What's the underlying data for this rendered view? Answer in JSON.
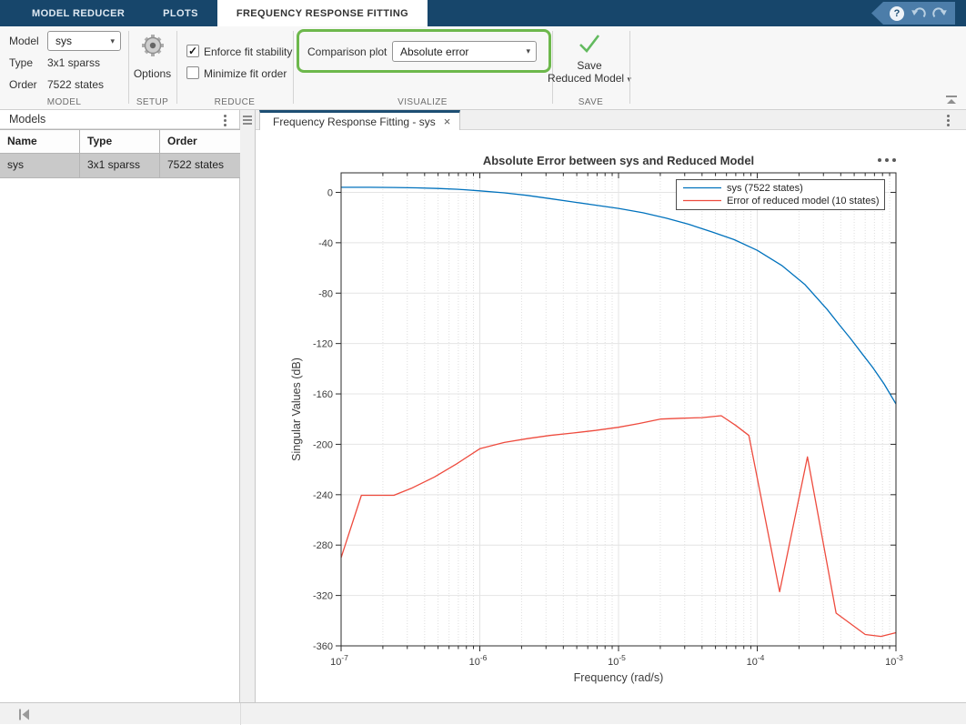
{
  "titlebar": {
    "tab_model_reducer": "MODEL REDUCER",
    "tab_plots": "PLOTS",
    "tab_frf": "FREQUENCY RESPONSE FITTING",
    "help_glyph": "?"
  },
  "ribbon": {
    "model": {
      "section": "MODEL",
      "model_label": "Model",
      "model_value": "sys",
      "type_label": "Type",
      "type_value": "3x1 sparss",
      "order_label": "Order",
      "order_value": "7522 states"
    },
    "setup": {
      "section": "SETUP",
      "options_label": "Options"
    },
    "reduce": {
      "section": "REDUCE",
      "cb1": {
        "label": "Enforce fit stability",
        "mark": "✓"
      },
      "cb2": {
        "label": "Minimize fit order",
        "mark": ""
      }
    },
    "visualize": {
      "section": "VISUALIZE",
      "label": "Comparison plot",
      "value": "Absolute error",
      "highlight_color": "#6db84c"
    },
    "save": {
      "section": "SAVE",
      "line1": "Save",
      "line2": "Reduced Model"
    }
  },
  "icons": {
    "dropdown_arrow": "▾",
    "save_arrow": "▾"
  },
  "models_panel": {
    "title": "Models",
    "headers": [
      "Name",
      "Type",
      "Order"
    ],
    "row": [
      "sys",
      "3x1 sparss",
      "7522 states"
    ]
  },
  "document": {
    "tab_title": "Frequency Response Fitting - sys",
    "close_glyph": "×"
  },
  "chart_data": {
    "type": "line",
    "title": "Absolute Error between sys and Reduced Model",
    "xlabel": "Frequency (rad/s)",
    "ylabel": "Singular Values (dB)",
    "x_scale": "log10",
    "xlim": [
      1e-07,
      0.001
    ],
    "ylim": [
      -360,
      15.5
    ],
    "yticks": [
      0,
      -40,
      -80,
      -120,
      -160,
      -200,
      -240,
      -280,
      -320,
      -360
    ],
    "xtick_decades": [
      -7,
      -6,
      -5,
      -4,
      -3
    ],
    "grid": true,
    "legend_position": "top-right",
    "series": [
      {
        "name": "sys (7522 states)",
        "color": "#0072BD",
        "points": [
          [
            1e-07,
            4
          ],
          [
            1.6e-07,
            4
          ],
          [
            2.4e-07,
            3.9
          ],
          [
            3.5e-07,
            3.6
          ],
          [
            5e-07,
            3.1
          ],
          [
            7e-07,
            2.4
          ],
          [
            1e-06,
            1.2
          ],
          [
            1.5e-06,
            -0.4
          ],
          [
            2.2e-06,
            -2.4
          ],
          [
            3.2e-06,
            -4.9
          ],
          [
            4.7e-06,
            -7.6
          ],
          [
            6.8e-06,
            -10.1
          ],
          [
            1e-05,
            -12.7
          ],
          [
            1.5e-05,
            -16.2
          ],
          [
            2.2e-05,
            -20.4
          ],
          [
            3.2e-05,
            -25.3
          ],
          [
            4.7e-05,
            -31.4
          ],
          [
            6.8e-05,
            -37.5
          ],
          [
            0.0001,
            -46
          ],
          [
            0.00015,
            -58
          ],
          [
            0.00022,
            -73
          ],
          [
            0.00032,
            -93
          ],
          [
            0.00039,
            -105
          ],
          [
            0.00047,
            -116
          ],
          [
            0.00056,
            -127
          ],
          [
            0.00068,
            -139
          ],
          [
            0.00082,
            -152
          ],
          [
            0.001,
            -168
          ]
        ]
      },
      {
        "name": "Error of reduced model (10 states)",
        "color": "#EE4B3E",
        "points": [
          [
            1e-07,
            -290
          ],
          [
            1.4e-07,
            -240.5
          ],
          [
            2.4e-07,
            -240.5
          ],
          [
            3.2e-07,
            -235
          ],
          [
            4.7e-07,
            -226
          ],
          [
            6.8e-07,
            -215.5
          ],
          [
            1e-06,
            -203.5
          ],
          [
            1.5e-06,
            -198.5
          ],
          [
            2.2e-06,
            -195.5
          ],
          [
            3.2e-06,
            -193
          ],
          [
            4.7e-06,
            -191
          ],
          [
            6.8e-06,
            -189
          ],
          [
            1e-05,
            -186.5
          ],
          [
            1.4e-05,
            -183.5
          ],
          [
            2e-05,
            -180
          ],
          [
            2.8e-05,
            -179.3
          ],
          [
            4e-05,
            -178.8
          ],
          [
            5.5e-05,
            -177.3
          ],
          [
            7e-05,
            -185
          ],
          [
            8.7e-05,
            -193
          ],
          [
            0.000145,
            -317
          ],
          [
            0.00023,
            -210
          ],
          [
            0.00037,
            -334
          ],
          [
            0.0006,
            -351
          ],
          [
            0.00078,
            -352.5
          ],
          [
            0.001,
            -349.5
          ]
        ]
      }
    ]
  }
}
